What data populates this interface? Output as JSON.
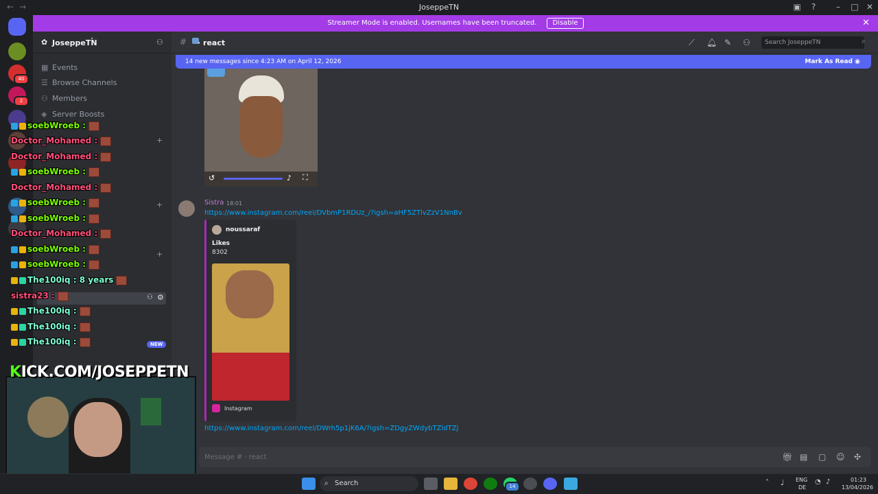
{
  "window": {
    "title": "JoseppeTN"
  },
  "banner": {
    "text": "Streamer Mode is enabled. Usernames have been truncated.",
    "disable_label": "Disable"
  },
  "rail": {
    "badge_1": "40",
    "badge_2": "2"
  },
  "sidebar": {
    "guild_name": "JoseppeTN",
    "items": [
      {
        "label": "Events"
      },
      {
        "label": "Browse Channels"
      },
      {
        "label": "Members"
      },
      {
        "label": "Server Boosts"
      }
    ],
    "new_badge": "NEW"
  },
  "channel": {
    "name": "react",
    "search_placeholder": "Search JoseppeTN"
  },
  "new_messages": {
    "text": "14 new messages since 4:23 AM on April 12, 2026",
    "mark_label": "Mark As Read"
  },
  "message": {
    "author": "Sistra",
    "time": "18:01",
    "link1": "https://www.instagram.com/reel/DVbmP1RDUz_/?igsh=aHF5ZTlvZzV1NnBv",
    "link2": "https://www.instagram.com/reel/DWrh5p1jK6A/?igsh=ZDgyZWdybTZldTZj",
    "embed": {
      "author": "noussaraf",
      "title": "Likes",
      "description": "8302",
      "footer": "Instagram"
    }
  },
  "composer": {
    "placeholder": "Message #  · react"
  },
  "overlay_chat": [
    {
      "user": "soebWroeb :",
      "color": "#7CFC00"
    },
    {
      "user": "Doctor_Mohamed :",
      "color": "#FF4F7B"
    },
    {
      "user": "Doctor_Mohamed :",
      "color": "#FF4F7B"
    },
    {
      "user": "soebWroeb :",
      "color": "#7CFC00"
    },
    {
      "user": "Doctor_Mohamed :",
      "color": "#FF4F7B"
    },
    {
      "user": "soebWroeb :",
      "color": "#7CFC00"
    },
    {
      "user": "soebWroeb :",
      "color": "#7CFC00"
    },
    {
      "user": "Doctor_Mohamed :",
      "color": "#FF4F7B"
    },
    {
      "user": "soebWroeb :",
      "color": "#7CFC00"
    },
    {
      "user": "soebWroeb :",
      "color": "#7CFC00"
    },
    {
      "user": "The100iq : 8 years",
      "color": "#7FFFD4"
    },
    {
      "user": "sistra23 :",
      "color": "#FF4F7B"
    },
    {
      "user": "The100iq :",
      "color": "#7FFFD4"
    },
    {
      "user": "The100iq :",
      "color": "#7FFFD4"
    },
    {
      "user": "The100iq :",
      "color": "#7FFFD4"
    }
  ],
  "stream": {
    "kick_k": "K",
    "kick_rest": "ICK.COM/JOSEPPETN"
  },
  "taskbar": {
    "search_label": "Search",
    "badge_whatsapp": "14",
    "lang1": "ENG",
    "lang2": "DE",
    "time": "01:23",
    "date": "13/04/2026"
  }
}
